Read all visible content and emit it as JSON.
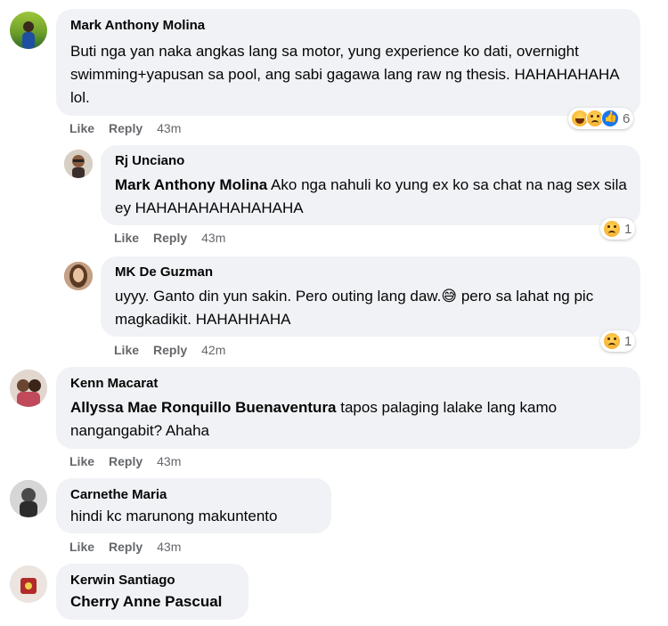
{
  "comments": [
    {
      "author": "Mark Anthony Molina",
      "text": "Buti nga yan naka angkas lang sa motor, yung experience ko dati, overnight swimming+yapusan sa pool, ang sabi gagawa lang raw ng thesis. HAHAHAHAHA lol.",
      "like": "Like",
      "reply": "Reply",
      "time": "43m",
      "reaction_count": "6",
      "reactions": [
        "haha-icon",
        "sad-icon",
        "like-icon"
      ]
    },
    {
      "author": "Rj Unciano",
      "mention": "Mark Anthony Molina",
      "text": " Ako nga nahuli ko yung ex ko sa chat na nag sex sila ey HAHAHAHAHAHAHAHA",
      "like": "Like",
      "reply": "Reply",
      "time": "43m",
      "reaction_count": "1",
      "reactions": [
        "sad-icon"
      ]
    },
    {
      "author": "MK De Guzman",
      "text": "uyyy. Ganto din yun sakin. Pero outing lang daw.",
      "text_after_emoji": " pero sa lahat ng pic magkadikit. HAHAHHAHA",
      "emoji": "😅",
      "like": "Like",
      "reply": "Reply",
      "time": "42m",
      "reaction_count": "1",
      "reactions": [
        "sad-icon"
      ]
    },
    {
      "author": "Kenn Macarat",
      "mention": "Allyssa Mae Ronquillo Buenaventura",
      "text": " tapos palaging lalake lang kamo nangangabit? Ahaha",
      "like": "Like",
      "reply": "Reply",
      "time": "43m"
    },
    {
      "author": "Carnethe Maria",
      "text": "hindi kc marunong makuntento",
      "like": "Like",
      "reply": "Reply",
      "time": "43m"
    },
    {
      "author": "Kerwin Santiago",
      "mention": "Cherry Anne Pascual"
    }
  ]
}
